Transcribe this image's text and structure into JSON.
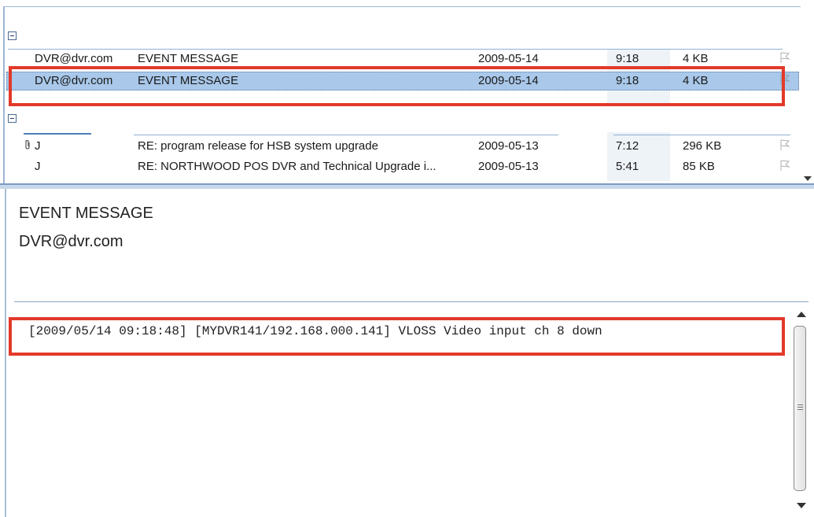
{
  "message_list": {
    "groups": [
      {
        "rows": [
          {
            "from": "DVR@dvr.com",
            "subject": "EVENT MESSAGE",
            "date": "2009-05-14",
            "time": "9:18",
            "size": "4 KB",
            "attachment": "",
            "selected": false
          },
          {
            "from": "DVR@dvr.com",
            "subject": "EVENT MESSAGE",
            "date": "2009-05-14",
            "time": "9:18",
            "size": "4 KB",
            "attachment": "",
            "selected": true
          }
        ]
      },
      {
        "rows": [
          {
            "from": "J",
            "subject": "RE: program release for HSB system upgrade",
            "date": "2009-05-13",
            "time": "7:12",
            "size": "296 KB",
            "attachment": "paperclip"
          },
          {
            "from": "J",
            "subject": "RE: NORTHWOOD POS DVR and Technical Upgrade i...",
            "date": "2009-05-13",
            "time": "5:41",
            "size": "85 KB",
            "attachment": ""
          }
        ]
      }
    ]
  },
  "reading_pane": {
    "subject": "EVENT MESSAGE",
    "sender": "DVR@dvr.com",
    "body": "[2009/05/14 09:18:48] [MYDVR141/192.168.000.141] VLOSS Video input ch 8 down"
  },
  "colors": {
    "selection": "#a9c8ea",
    "callout": "#e23a2a",
    "border": "#9db6d3"
  },
  "icons": {
    "group_toggle": "collapse-icon",
    "flag": "flag-icon",
    "attachment": "paperclip-icon"
  }
}
